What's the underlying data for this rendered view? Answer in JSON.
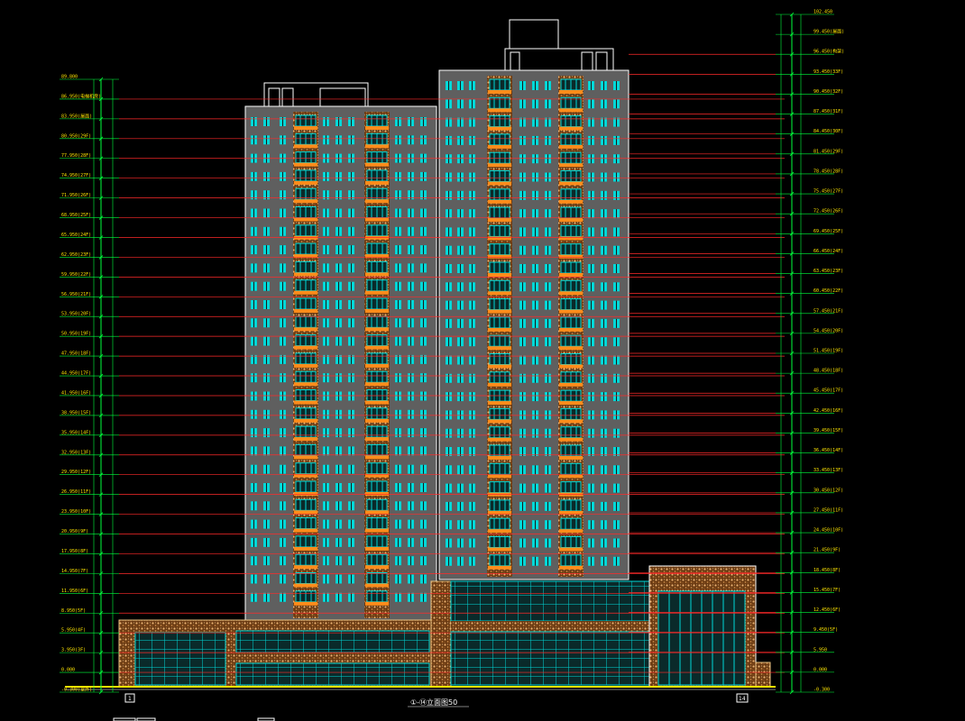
{
  "drawing": {
    "caption": "①-⑭立面图50",
    "axis_left": "1",
    "axis_right": "14",
    "colors": {
      "background": "#000000",
      "level_line": "#ff2a2a",
      "dimension": "#00ff3c",
      "facade": "#5f5f5f",
      "window": "#00d8d8",
      "balcony": "#ff8c1a",
      "stone": "#d4a266",
      "outline": "#ffffff",
      "text": "#ffe600",
      "ground": "#ffe600"
    },
    "left_levels": [
      "89.800",
      "86.950(电梯机房)",
      "83.950(屋面)",
      "80.950(29F)",
      "77.950(28F)",
      "74.950(27F)",
      "71.950(26F)",
      "68.950(25F)",
      "65.950(24F)",
      "62.950(23F)",
      "59.950(22F)",
      "56.950(21F)",
      "53.950(20F)",
      "50.950(19F)",
      "47.950(18F)",
      "44.950(17F)",
      "41.950(16F)",
      "38.950(15F)",
      "35.950(14F)",
      "32.950(13F)",
      "29.950(12F)",
      "26.950(11F)",
      "23.950(10F)",
      "20.950(9F)",
      "17.950(8F)",
      "14.950(7F)",
      "11.950(6F)",
      "8.950(5F)",
      "5.950(4F)",
      "3.950(3F)",
      "0.000",
      "-0.300(室外)"
    ],
    "right_levels": [
      "102.450",
      "99.450(屋面)",
      "96.450(构架)",
      "93.450(33F)",
      "90.450(32F)",
      "87.450(31F)",
      "84.450(30F)",
      "81.450(29F)",
      "78.450(28F)",
      "75.450(27F)",
      "72.450(26F)",
      "69.450(25F)",
      "66.450(24F)",
      "63.450(23F)",
      "60.450(22F)",
      "57.450(21F)",
      "54.450(20F)",
      "51.450(19F)",
      "48.450(18F)",
      "45.450(17F)",
      "42.450(16F)",
      "39.450(15F)",
      "36.450(14F)",
      "33.450(13F)",
      "30.450(12F)",
      "27.450(11F)",
      "24.450(10F)",
      "21.450(9F)",
      "18.450(8F)",
      "15.450(7F)",
      "12.450(6F)",
      "9.450(5F)",
      "5.950",
      "0.000",
      "-0.300"
    ]
  }
}
